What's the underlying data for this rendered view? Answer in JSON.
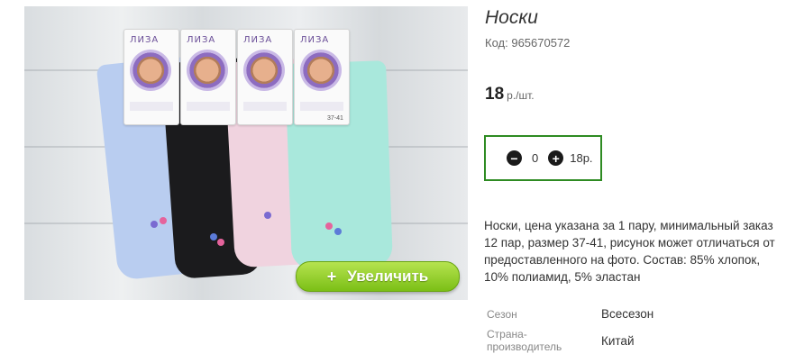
{
  "product": {
    "title": "Носки",
    "code_label": "Код:",
    "code": "965670572",
    "price": "18",
    "price_unit": "р./шт.",
    "description": "Носки, цена указана за 1 пару, минимальный заказ 12 пар, размер 37-41, рисунок может отличаться от предоставленного на фото. Состав: 85% хлопок, 10% полиамид, 5% эластан"
  },
  "quantity": {
    "value": "0",
    "total": "18р."
  },
  "image": {
    "enlarge_label": "Увеличить",
    "enlarge_icon": "+",
    "package_brand": "ЛИЗА",
    "size_tag": "37-41"
  },
  "specs": [
    {
      "label": "Сезон",
      "value": "Всесезон"
    },
    {
      "label": "Страна-\nпроизводитель",
      "value": "Китай"
    }
  ],
  "colors": {
    "accent_green": "#2e8b22",
    "button_green": "#8cc926",
    "sock_blue": "#b9cdf0",
    "sock_black": "#1b1b1d",
    "sock_pink": "#f0d3df",
    "sock_mint": "#a9e8dc"
  }
}
